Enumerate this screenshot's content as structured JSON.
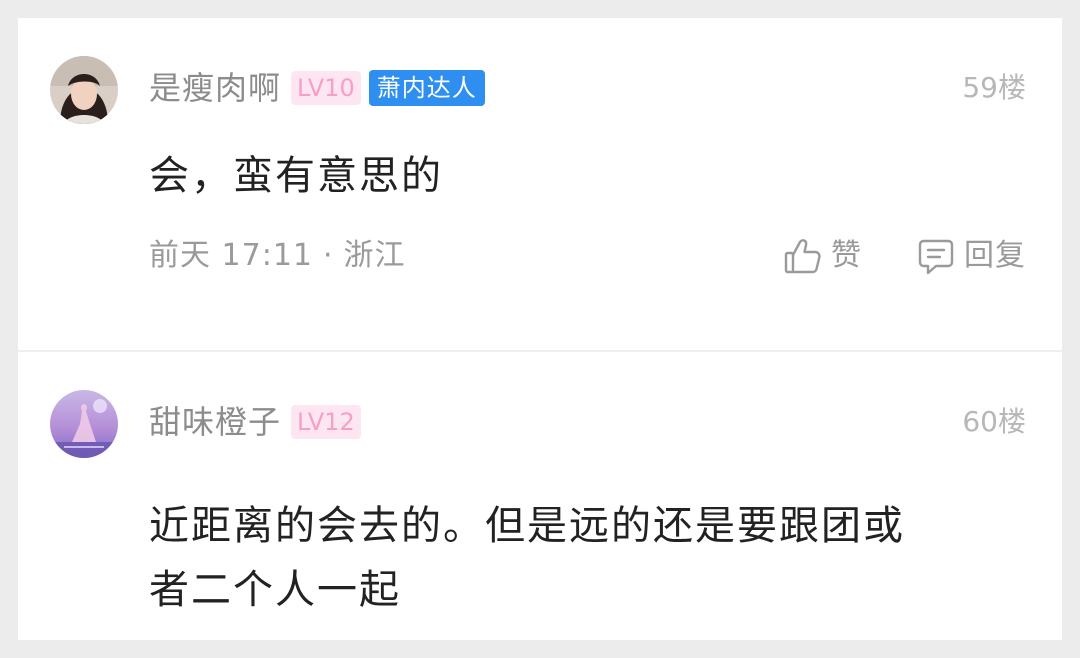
{
  "comments": [
    {
      "username": "是瘦肉啊",
      "level": "LV10",
      "title_badge": "萧内达人",
      "floor": "59楼",
      "content": "会，蛮有意思的",
      "time": "前天 17:11",
      "separator": "·",
      "location": "浙江",
      "like_label": "赞",
      "reply_label": "回复"
    },
    {
      "username": "甜味橙子",
      "level": "LV12",
      "floor": "60楼",
      "content_line1": "近距离的会去的。但是远的还是要跟团或",
      "content_line2": "者二个人一起"
    }
  ],
  "icons": {
    "like": "thumbs-up-icon",
    "reply": "chat-bubble-icon"
  },
  "colors": {
    "badge_blue": "#2f8ff0",
    "level_pink_bg": "#fde6f1",
    "level_pink_text": "#f6a0c6",
    "username": "#8c8c8c",
    "meta": "#9a9a9a",
    "content": "#222222"
  }
}
